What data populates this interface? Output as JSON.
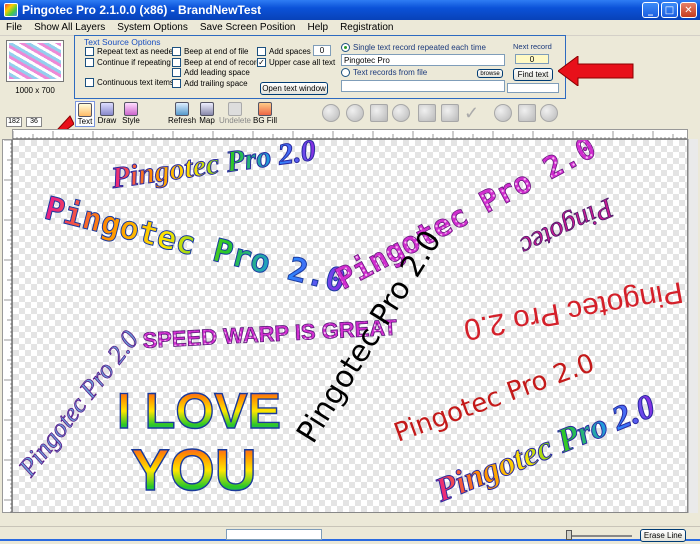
{
  "window": {
    "title": "Pingotec Pro 2.1.0.0 (x86) - BrandNewTest"
  },
  "menu": [
    "File",
    "Show All Layers",
    "System Options",
    "Save Screen Position",
    "Help",
    "Registration"
  ],
  "thumbnail": {
    "size_label": "1000 x 700"
  },
  "size_boxes": [
    "182",
    "36"
  ],
  "text_source": {
    "title": "Text Source Options",
    "options": {
      "repeat": "Repeat text as needed",
      "continue": "Continue if repeating",
      "continuous": "Continuous text items",
      "beep_file": "Beep at end of file",
      "beep_record": "Beep at end of record",
      "leading": "Add leading space",
      "trailing": "Add trailing space",
      "spaces": "Add spaces",
      "upper": "Upper case all text"
    },
    "spaces_value": "0",
    "open_window": "Open text window",
    "single_label": "Single text record repeated each time",
    "single_value": "Pingotec Pro",
    "file_label": "Text records from file",
    "browse": "browse",
    "next_record_label": "Next record",
    "next_record_value": "0",
    "find_text": "Find text"
  },
  "toolbar": {
    "text": "Text",
    "draw": "Draw",
    "style": "Style",
    "refresh": "Refresh",
    "map": "Map",
    "undelete": "Undelete",
    "bgfill": "BG Fill"
  },
  "canvas_texts": {
    "t1": "Pingotec Pro 2.0",
    "t2": "Pingotec Pro 2.0",
    "t3": "Pingotec Pro 2.0",
    "t4": "Pingotec",
    "t5": "Pingotec Pro 2.0",
    "t6": "SPEED WARP IS GREAT",
    "t7": "Pingotec Pro 2.0",
    "t8a": "I LOVE",
    "t8b": "YOU",
    "t9": "Pingotec Pro 2.0",
    "t10": "Pingotec Pro 2.0",
    "t11": "Pingotec Pro 2.0"
  },
  "status": {
    "erase_line": "Erase Line"
  },
  "colors": {
    "title_bar": "#0b52d8",
    "arrow": "#e8101a",
    "rainbow": [
      "#e81b8c",
      "#ff8a00",
      "#ffe600",
      "#28c828",
      "#2090ff",
      "#8a2be2"
    ]
  }
}
